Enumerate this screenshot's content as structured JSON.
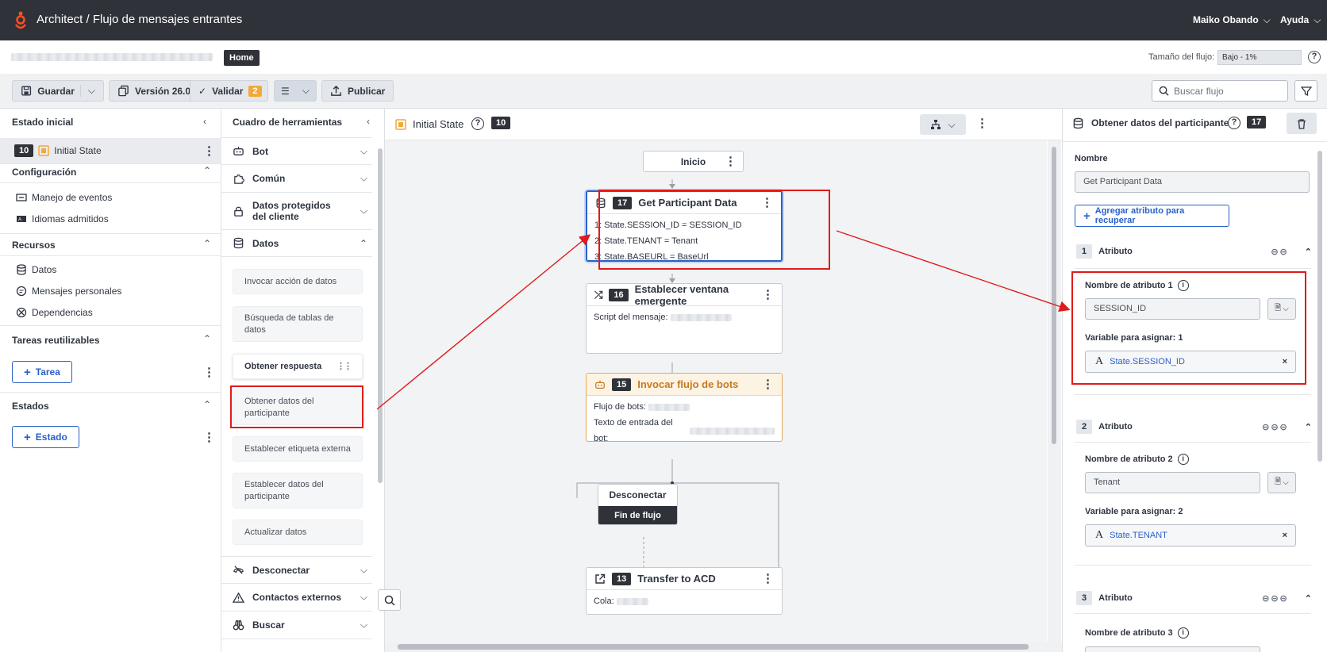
{
  "topbar": {
    "app_title": "Architect / Flujo de mensajes entrantes",
    "user": "Maiko Obando",
    "help": "Ayuda"
  },
  "secbar": {
    "home_tag": "Home",
    "flow_size_label": "Tamaño del flujo:",
    "flow_size_value": "Bajo - 1%"
  },
  "toolbar": {
    "save": "Guardar",
    "version": "Versión 26.0",
    "validate": "Validar",
    "validate_count": "2",
    "publish": "Publicar",
    "search_placeholder": "Buscar flujo"
  },
  "left": {
    "initial_state_header": "Estado inicial",
    "initial_state_num": "10",
    "initial_state_name": "Initial State",
    "config_header": "Configuración",
    "config_items": [
      "Manejo de eventos",
      "Idiomas admitidos"
    ],
    "resources_header": "Recursos",
    "resources_items": [
      "Datos",
      "Mensajes personales",
      "Dependencias"
    ],
    "tasks_header": "Tareas reutilizables",
    "task_button": "Tarea",
    "states_header": "Estados",
    "state_button": "Estado"
  },
  "toolbox": {
    "header": "Cuadro de herramientas",
    "categories": [
      "Bot",
      "Común",
      "Datos protegidos del cliente",
      "Datos",
      "Desconectar",
      "Contactos externos",
      "Buscar"
    ],
    "tools": [
      "Invocar acción de datos",
      "Búsqueda de tablas de datos",
      "Obtener respuesta",
      "Obtener datos del participante",
      "Establecer etiqueta externa",
      "Establecer datos del participante",
      "Actualizar datos"
    ]
  },
  "canvas": {
    "state_name": "Initial State",
    "state_num": "10",
    "start_label": "Inicio",
    "node17": {
      "num": "17",
      "title": "Get Participant Data",
      "lines": [
        "1: State.SESSION_ID = SESSION_ID",
        "2: State.TENANT = Tenant",
        "3: State.BASEURL = BaseUrl"
      ]
    },
    "node16": {
      "num": "16",
      "title": "Establecer ventana emergente",
      "line": "Script del mensaje:"
    },
    "node15": {
      "num": "15",
      "title": "Invocar flujo de bots",
      "line1": "Flujo de bots:",
      "line2": "Texto de entrada del bot:"
    },
    "disconnect": {
      "title": "Desconectar",
      "footer": "Fin de flujo"
    },
    "node13": {
      "num": "13",
      "title": "Transfer to ACD",
      "line": "Cola:"
    }
  },
  "right": {
    "title": "Obtener datos del participante",
    "num": "17",
    "name_label": "Nombre",
    "name_value": "Get Participant Data",
    "add_attr_button": "Agregar atributo para recuperar",
    "attr_heading": "Atributo",
    "attrs": [
      {
        "n": "1",
        "label": "Nombre de atributo 1",
        "value": "SESSION_ID",
        "var_label": "Variable para asignar: 1",
        "var": "State.SESSION_ID"
      },
      {
        "n": "2",
        "label": "Nombre de atributo 2",
        "value": "Tenant",
        "var_label": "Variable para asignar: 2",
        "var": "State.TENANT"
      },
      {
        "n": "3",
        "label": "Nombre de atributo 3"
      }
    ]
  },
  "colors": {
    "topbar": "#2f3238",
    "accent_blue": "#2a60c8",
    "highlight_red": "#e01b1b",
    "bot_orange": "#c9781f",
    "validate_badge": "#f2a93b"
  }
}
